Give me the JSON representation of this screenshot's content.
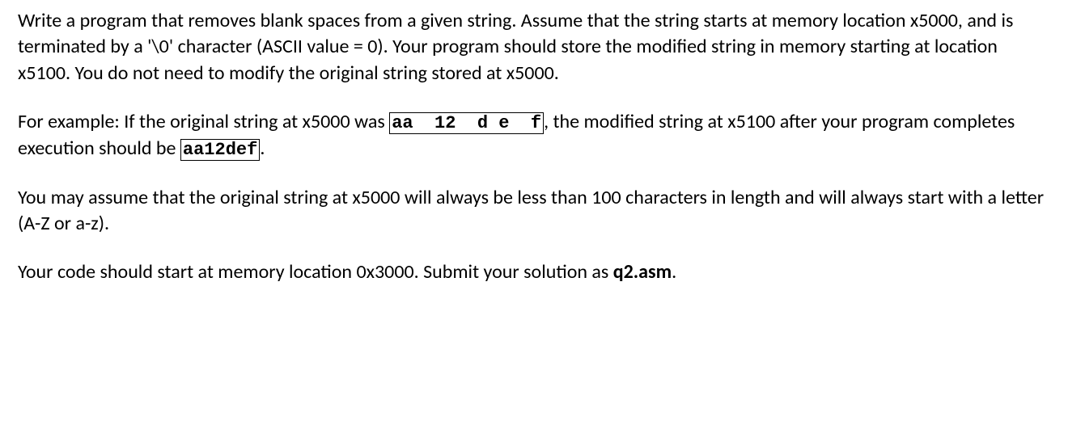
{
  "paragraphs": {
    "p1": "Write a program that removes blank spaces from a given string. Assume that the string starts at memory location x5000, and is terminated by a '\\0' character (ASCII value = 0). Your program should store the modified string in memory starting at location x5100. You do not need to modify the original string stored at x5000.",
    "p2_a": "For example: If the original string at x5000 was ",
    "p2_code1": "aa  12  d e  f",
    "p2_b": ", the modified string at x5100 after your program completes execution should be ",
    "p2_code2": "aa12def",
    "p2_c": ".",
    "p3": "You may assume that the original string at x5000 will always be less than 100 characters in length and will always start with a letter (A-Z or a-z).",
    "p4_a": "Your code should start at memory location 0x3000. Submit your solution as ",
    "p4_bold": "q2.asm",
    "p4_b": "."
  }
}
